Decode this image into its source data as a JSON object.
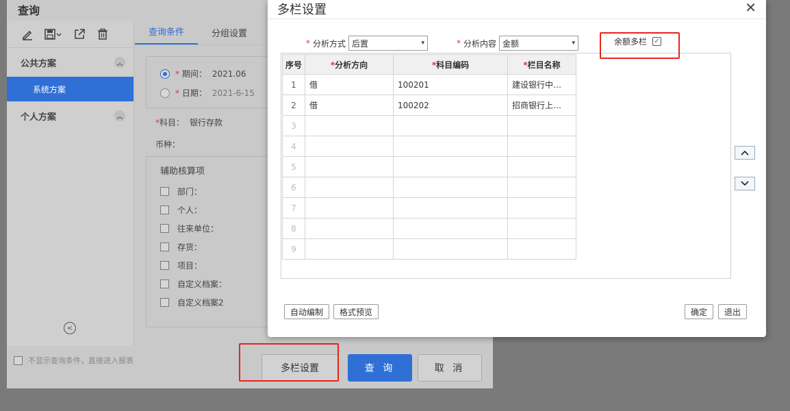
{
  "query_window": {
    "title": "查询",
    "plans": {
      "public_group": "公共方案",
      "system_plan": "系统方案",
      "personal_group": "个人方案"
    },
    "tabs": [
      "查询条件",
      "分组设置"
    ],
    "period": {
      "label": "期间：",
      "value": "2021.06"
    },
    "date": {
      "label": "日期：",
      "value": "2021-6-15"
    },
    "subject": {
      "label": "科目：",
      "value": "银行存款"
    },
    "currency": {
      "label": "币种："
    },
    "aux": {
      "title": "辅助核算项",
      "items": [
        "部门：",
        "个人：",
        "往来单位：",
        "存货：",
        "项目：",
        "自定义档案："
      ],
      "partial_item": "自定义档案2"
    },
    "skip_conditions": "不显示查询条件，直接进入报表",
    "multi_column_button": "多栏设置",
    "query_button": "查 询",
    "cancel_button": "取 消"
  },
  "dialog": {
    "title": "多栏设置",
    "close_symbol": "✕",
    "analysis_method": {
      "label": "分析方式",
      "value": "后置"
    },
    "analysis_content": {
      "label": "分析内容",
      "value": "金额"
    },
    "balance_multi": {
      "label": "余额多栏",
      "checked": true
    },
    "table": {
      "headers": [
        "序号",
        "分析方向",
        "科目编码",
        "栏目名称"
      ],
      "rows": [
        [
          "1",
          "借",
          "100201",
          "建设银行中…"
        ],
        [
          "2",
          "借",
          "100202",
          "招商银行上…"
        ],
        [
          "3",
          "",
          "",
          ""
        ],
        [
          "4",
          "",
          "",
          ""
        ],
        [
          "5",
          "",
          "",
          ""
        ],
        [
          "6",
          "",
          "",
          ""
        ],
        [
          "7",
          "",
          "",
          ""
        ],
        [
          "8",
          "",
          "",
          ""
        ],
        [
          "9",
          "",
          "",
          ""
        ]
      ]
    },
    "auto_button": "自动编制",
    "preview_button": "格式预览",
    "ok_button": "确定",
    "exit_button": "退出"
  },
  "colors": {
    "accent": "#2f6fd6",
    "highlight": "#e8231a"
  },
  "icons": [
    "edit-icon",
    "save-icon",
    "export-icon",
    "delete-icon",
    "chevron-up-icon",
    "collapse-left-icon",
    "close-icon",
    "move-up-icon",
    "move-down-icon"
  ]
}
